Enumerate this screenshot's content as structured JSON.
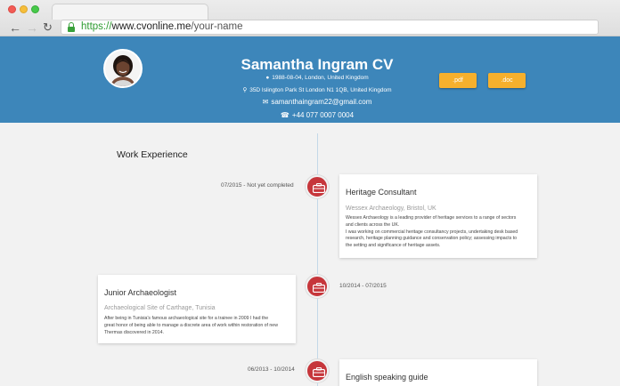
{
  "browser": {
    "url_scheme": "https://",
    "url_host": "www.cvonline.me",
    "url_path": "/your-name"
  },
  "profile": {
    "name": "Samantha Ingram CV",
    "birth_location": "1988-08-04, London, United Kingdom",
    "address": "35D Islington Park St London N1 1QB, United Kingdom",
    "email": "samanthaingram22@gmail.com",
    "phone": "+44 077 0007 0004"
  },
  "downloads": {
    "pdf_label": ".pdf",
    "doc_label": ".doc"
  },
  "section": {
    "title": "Work Experience"
  },
  "experience": [
    {
      "date": "07/2015 - Not yet completed",
      "title": "Heritage Consultant",
      "company": "Wessex Archaeology, Bristol, UK",
      "description_lines": [
        "Wessex Archaeology is a leading provider of heritage services to a range of sectors",
        "and clients across the UK.",
        "I was working on commercial heritage consultancy projects, undertaking desk based",
        "research, heritage planning guidance and conservation policy; assessing impacts to",
        "the setting and significance of heritage assets."
      ]
    },
    {
      "date": "10/2014 - 07/2015",
      "title": "Junior Archaeologist",
      "company": "Archaeological Site of Carthage, Tunisia",
      "description_lines": [
        "After being in Tunisia's famous archaeological site for a trainee in 2009 I had the",
        "great honor of being able to manage a discrete area of work within restoration of new",
        "Thermas discovered in 2014."
      ]
    },
    {
      "date": "06/2013 - 10/2014",
      "title": "English speaking guide",
      "company": "",
      "description_lines": []
    }
  ],
  "colors": {
    "header": "#3d86ba",
    "accent_button": "#f6b02d",
    "timeline_marker": "#c6363b"
  },
  "icons": {
    "back": "arrow-left-icon",
    "forward": "arrow-right-icon",
    "reload": "reload-icon",
    "secure": "lock-icon",
    "marker": "briefcase-icon",
    "birth": "globe-icon",
    "address": "map-marker-icon",
    "email": "envelope-icon",
    "phone": "phone-icon"
  }
}
